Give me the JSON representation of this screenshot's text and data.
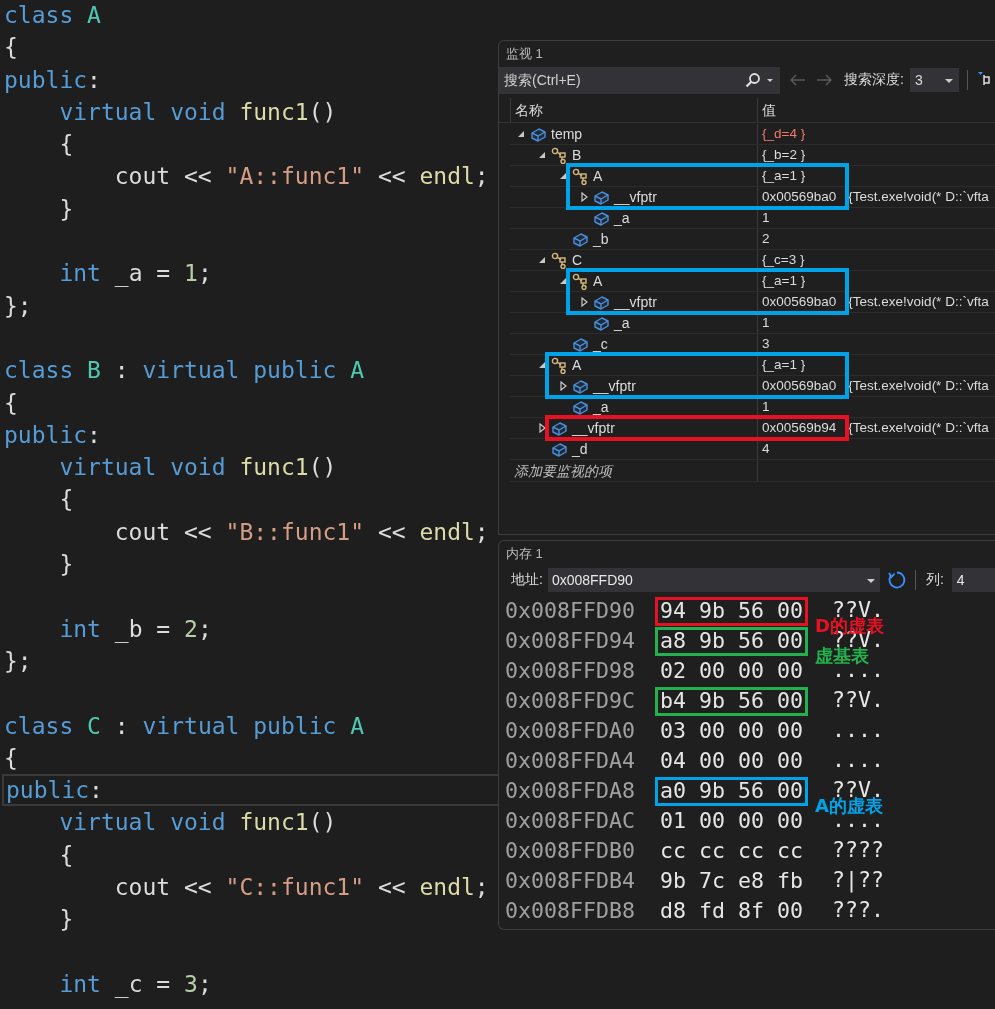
{
  "editor": {
    "lines": [
      {
        "current": false,
        "tokens": [
          {
            "kind": "kw",
            "text": "class "
          },
          {
            "kind": "type",
            "text": "A"
          }
        ]
      },
      {
        "current": false,
        "tokens": [
          {
            "kind": "plain",
            "text": "{"
          }
        ]
      },
      {
        "current": false,
        "tokens": [
          {
            "kind": "kw",
            "text": "public"
          },
          {
            "kind": "plain",
            "text": ":"
          }
        ]
      },
      {
        "current": false,
        "tokens": [
          {
            "kind": "kw",
            "text": "    virtual void "
          },
          {
            "kind": "fn",
            "text": "func1"
          },
          {
            "kind": "plain",
            "text": "()"
          }
        ]
      },
      {
        "current": false,
        "tokens": [
          {
            "kind": "plain",
            "text": "    {"
          }
        ]
      },
      {
        "current": false,
        "tokens": [
          {
            "kind": "plain",
            "text": "        cout << "
          },
          {
            "kind": "str",
            "text": "\"A::func1\""
          },
          {
            "kind": "plain",
            "text": " << "
          },
          {
            "kind": "fn",
            "text": "endl"
          },
          {
            "kind": "plain",
            "text": ";"
          }
        ]
      },
      {
        "current": false,
        "tokens": [
          {
            "kind": "plain",
            "text": "    }"
          }
        ]
      },
      {
        "current": false
      },
      {
        "current": false,
        "tokens": [
          {
            "kind": "kw",
            "text": "    int "
          },
          {
            "kind": "plain",
            "text": "_a = "
          },
          {
            "kind": "num",
            "text": "1"
          },
          {
            "kind": "plain",
            "text": ";"
          }
        ]
      },
      {
        "current": false,
        "tokens": [
          {
            "kind": "plain",
            "text": "};"
          }
        ]
      },
      {
        "current": false
      },
      {
        "current": false,
        "tokens": [
          {
            "kind": "kw",
            "text": "class "
          },
          {
            "kind": "type",
            "text": "B"
          },
          {
            "kind": "plain",
            "text": " : "
          },
          {
            "kind": "kw",
            "text": "virtual public "
          },
          {
            "kind": "type",
            "text": "A"
          }
        ]
      },
      {
        "current": false,
        "tokens": [
          {
            "kind": "plain",
            "text": "{"
          }
        ]
      },
      {
        "current": false,
        "tokens": [
          {
            "kind": "kw",
            "text": "public"
          },
          {
            "kind": "plain",
            "text": ":"
          }
        ]
      },
      {
        "current": false,
        "tokens": [
          {
            "kind": "kw",
            "text": "    virtual void "
          },
          {
            "kind": "fn",
            "text": "func1"
          },
          {
            "kind": "plain",
            "text": "()"
          }
        ]
      },
      {
        "current": false,
        "tokens": [
          {
            "kind": "plain",
            "text": "    {"
          }
        ]
      },
      {
        "current": false,
        "tokens": [
          {
            "kind": "plain",
            "text": "        cout << "
          },
          {
            "kind": "str",
            "text": "\"B::func1\""
          },
          {
            "kind": "plain",
            "text": " << "
          },
          {
            "kind": "fn",
            "text": "endl"
          },
          {
            "kind": "plain",
            "text": ";"
          }
        ]
      },
      {
        "current": false,
        "tokens": [
          {
            "kind": "plain",
            "text": "    }"
          }
        ]
      },
      {
        "current": false
      },
      {
        "current": false,
        "tokens": [
          {
            "kind": "kw",
            "text": "    int "
          },
          {
            "kind": "plain",
            "text": "_b = "
          },
          {
            "kind": "num",
            "text": "2"
          },
          {
            "kind": "plain",
            "text": ";"
          }
        ]
      },
      {
        "current": false,
        "tokens": [
          {
            "kind": "plain",
            "text": "};"
          }
        ]
      },
      {
        "current": false
      },
      {
        "current": false,
        "tokens": [
          {
            "kind": "kw",
            "text": "class "
          },
          {
            "kind": "type",
            "text": "C"
          },
          {
            "kind": "plain",
            "text": " : "
          },
          {
            "kind": "kw",
            "text": "virtual public "
          },
          {
            "kind": "type",
            "text": "A"
          }
        ]
      },
      {
        "current": false,
        "tokens": [
          {
            "kind": "plain",
            "text": "{"
          }
        ]
      },
      {
        "current": true,
        "tokens": [
          {
            "kind": "kw",
            "text": "public"
          },
          {
            "kind": "plain",
            "text": ":"
          }
        ]
      },
      {
        "current": false,
        "tokens": [
          {
            "kind": "kw",
            "text": "    virtual void "
          },
          {
            "kind": "fn",
            "text": "func1"
          },
          {
            "kind": "plain",
            "text": "()"
          }
        ]
      },
      {
        "current": false,
        "tokens": [
          {
            "kind": "plain",
            "text": "    {"
          }
        ]
      },
      {
        "current": false,
        "tokens": [
          {
            "kind": "plain",
            "text": "        cout << "
          },
          {
            "kind": "str",
            "text": "\"C::func1\""
          },
          {
            "kind": "plain",
            "text": " << "
          },
          {
            "kind": "fn",
            "text": "endl"
          },
          {
            "kind": "plain",
            "text": ";"
          }
        ]
      },
      {
        "current": false,
        "tokens": [
          {
            "kind": "plain",
            "text": "    }"
          }
        ]
      },
      {
        "current": false
      },
      {
        "current": false,
        "tokens": [
          {
            "kind": "kw",
            "text": "    int "
          },
          {
            "kind": "plain",
            "text": "_c = "
          },
          {
            "kind": "num",
            "text": "3"
          },
          {
            "kind": "plain",
            "text": ";"
          }
        ]
      }
    ]
  },
  "watch": {
    "title": "监视 1",
    "search": {
      "placeholder": "搜索(Ctrl+E)"
    },
    "navigation": [
      {
        "kind": "back",
        "disabled": true
      },
      {
        "kind": "forward",
        "disabled": true
      }
    ],
    "depth_label": "搜索深度:",
    "depth_value": "3",
    "columns": [
      "名称",
      "值"
    ],
    "items": [
      {
        "name": "temp",
        "value": "{_d=4 }",
        "kind": "field",
        "expanded": true,
        "changed": true,
        "children": [
          {
            "name": "B",
            "value": "{_b=2 }",
            "kind": "base",
            "expanded": true,
            "changed": false,
            "children": [
              {
                "name": "A",
                "value": "{_a=1 }",
                "kind": "base",
                "expanded": true,
                "changed": false,
                "outline": {
                  "color": "#00a2e8",
                  "kind": "pair"
                },
                "children": [
                  {
                    "name": "__vfptr",
                    "value": "0x00569ba0",
                    "detail": "{Test.exe!void(* D::`vfta",
                    "kind": "field",
                    "expanded": false,
                    "changed": false
                  },
                  {
                    "name": "_a",
                    "value": "1",
                    "kind": "field",
                    "changed": false
                  }
                ]
              },
              {
                "name": "_b",
                "value": "2",
                "kind": "field",
                "changed": false
              }
            ]
          },
          {
            "name": "C",
            "value": "{_c=3 }",
            "kind": "base",
            "expanded": true,
            "changed": false,
            "children": [
              {
                "name": "A",
                "value": "{_a=1 }",
                "kind": "base",
                "expanded": true,
                "changed": false,
                "outline": {
                  "color": "#00a2e8",
                  "kind": "pair"
                },
                "children": [
                  {
                    "name": "__vfptr",
                    "value": "0x00569ba0",
                    "detail": "{Test.exe!void(* D::`vfta",
                    "kind": "field",
                    "expanded": false,
                    "changed": false
                  },
                  {
                    "name": "_a",
                    "value": "1",
                    "kind": "field",
                    "changed": false
                  }
                ]
              },
              {
                "name": "_c",
                "value": "3",
                "kind": "field",
                "changed": false
              }
            ]
          },
          {
            "name": "A",
            "value": "{_a=1 }",
            "kind": "base",
            "expanded": true,
            "changed": false,
            "outline": {
              "color": "#00a2e8",
              "kind": "pair"
            },
            "children": [
              {
                "name": "__vfptr",
                "value": "0x00569ba0",
                "detail": "{Test.exe!void(* D::`vfta",
                "kind": "field",
                "expanded": false,
                "changed": false
              },
              {
                "name": "_a",
                "value": "1",
                "kind": "field",
                "changed": false
              }
            ]
          },
          {
            "name": "__vfptr",
            "value": "0x00569b94",
            "detail": "{Test.exe!void(* D::`vfta",
            "kind": "field",
            "expanded": false,
            "changed": false,
            "outline": {
              "color": "#e81123",
              "kind": "single"
            }
          },
          {
            "name": "_d",
            "value": "4",
            "kind": "field",
            "changed": false
          }
        ]
      }
    ],
    "add_item": {
      "placeholder": "添加要监视的项"
    }
  },
  "memory": {
    "title": "内存 1",
    "address_label": "地址:",
    "address": "0x008FFD90",
    "columns_label": "列:",
    "columns_value": "4",
    "rows": [
      {
        "address": "0x008FFD90",
        "bytes": "94 9b 56 00",
        "ascii": "??V.",
        "mark": {
          "color": "#e81123",
          "label": "D的虚表"
        }
      },
      {
        "address": "0x008FFD94",
        "bytes": "a8 9b 56 00",
        "ascii": "??V.",
        "mark": {
          "color": "#22b14c",
          "label": "虚基表"
        }
      },
      {
        "address": "0x008FFD98",
        "bytes": "02 00 00 00",
        "ascii": "...."
      },
      {
        "address": "0x008FFD9C",
        "bytes": "b4 9b 56 00",
        "ascii": "??V.",
        "mark": {
          "color": "#22b14c"
        }
      },
      {
        "address": "0x008FFDA0",
        "bytes": "03 00 00 00",
        "ascii": "...."
      },
      {
        "address": "0x008FFDA4",
        "bytes": "04 00 00 00",
        "ascii": "...."
      },
      {
        "address": "0x008FFDA8",
        "bytes": "a0 9b 56 00",
        "ascii": "??V.",
        "mark": {
          "color": "#00a2e8",
          "label": "A的虚表"
        }
      },
      {
        "address": "0x008FFDAC",
        "bytes": "01 00 00 00",
        "ascii": "...."
      },
      {
        "address": "0x008FFDB0",
        "bytes": "cc cc cc cc",
        "ascii": "????"
      },
      {
        "address": "0x008FFDB4",
        "bytes": "9b 7c e8 fb",
        "ascii": "?|??"
      },
      {
        "address": "0x008FFDB8",
        "bytes": "d8 fd 8f 00",
        "ascii": "???."
      }
    ]
  }
}
